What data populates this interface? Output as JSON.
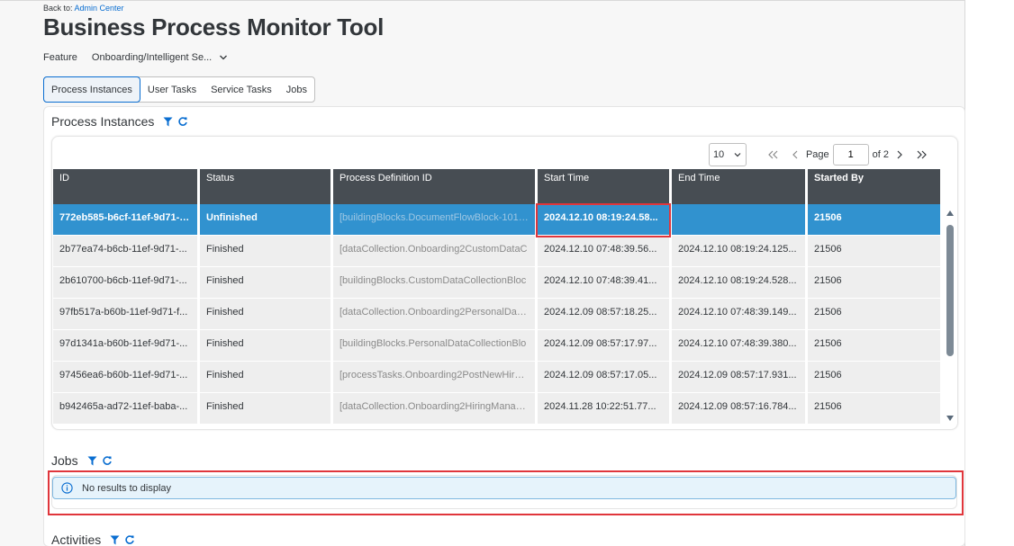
{
  "header": {
    "back_prefix": "Back to:",
    "back_link": "Admin Center",
    "title": "Business Process Monitor Tool"
  },
  "feature": {
    "label": "Feature",
    "selected": "Onboarding/Intelligent Se..."
  },
  "tabs": [
    {
      "label": "Process Instances",
      "active": true
    },
    {
      "label": "User Tasks",
      "active": false
    },
    {
      "label": "Service Tasks",
      "active": false
    },
    {
      "label": "Jobs",
      "active": false
    }
  ],
  "process_instances": {
    "title": "Process Instances",
    "pager": {
      "page_size": "10",
      "page_label": "Page",
      "current_page": "1",
      "of_label": "of 2"
    },
    "columns": [
      "ID",
      "Status",
      "Process Definition ID",
      "Start Time",
      "End Time",
      "Started By"
    ],
    "rows": [
      {
        "id": "772eb585-b6cf-11ef-9d71-f...",
        "status": "Unfinished",
        "pdid": "[buildingBlocks.DocumentFlowBlock-101-[c",
        "start": "2024.12.10 08:19:24.58...",
        "end": "",
        "by": "21506",
        "selected": true
      },
      {
        "id": "2b77ea74-b6cb-11ef-9d71-...",
        "status": "Finished",
        "pdid": "[dataCollection.Onboarding2CustomDataC",
        "start": "2024.12.10 07:48:39.56...",
        "end": "2024.12.10 08:19:24.125...",
        "by": "21506",
        "selected": false
      },
      {
        "id": "2b610700-b6cb-11ef-9d71-...",
        "status": "Finished",
        "pdid": "[buildingBlocks.CustomDataCollectionBloc",
        "start": "2024.12.10 07:48:39.41...",
        "end": "2024.12.10 08:19:24.528...",
        "by": "21506",
        "selected": false
      },
      {
        "id": "97fb517a-b60b-11ef-9d71-f...",
        "status": "Finished",
        "pdid": "[dataCollection.Onboarding2PersonalDataC",
        "start": "2024.12.09 08:57:18.25...",
        "end": "2024.12.10 07:48:39.149...",
        "by": "21506",
        "selected": false
      },
      {
        "id": "97d1341a-b60b-11ef-9d71-...",
        "status": "Finished",
        "pdid": "[buildingBlocks.PersonalDataCollectionBlo",
        "start": "2024.12.09 08:57:17.97...",
        "end": "2024.12.10 07:48:39.380...",
        "by": "21506",
        "selected": false
      },
      {
        "id": "97456ea6-b60b-11ef-9d71-...",
        "status": "Finished",
        "pdid": "[processTasks.Onboarding2PostNewHireDa",
        "start": "2024.12.09 08:57:17.05...",
        "end": "2024.12.09 08:57:17.931...",
        "by": "21506",
        "selected": false
      },
      {
        "id": "b942465a-ad72-11ef-baba-...",
        "status": "Finished",
        "pdid": "[dataCollection.Onboarding2HiringManager",
        "start": "2024.11.28 10:22:51.77...",
        "end": "2024.12.09 08:57:16.784...",
        "by": "21506",
        "selected": false
      }
    ]
  },
  "jobs": {
    "title": "Jobs",
    "empty_message": "No results to display"
  },
  "activities": {
    "title": "Activities"
  },
  "colors": {
    "header_bg": "#474d53",
    "selected_row": "#3192cf",
    "highlight": "#e0363c",
    "info_strip": "#e6f3fb"
  }
}
